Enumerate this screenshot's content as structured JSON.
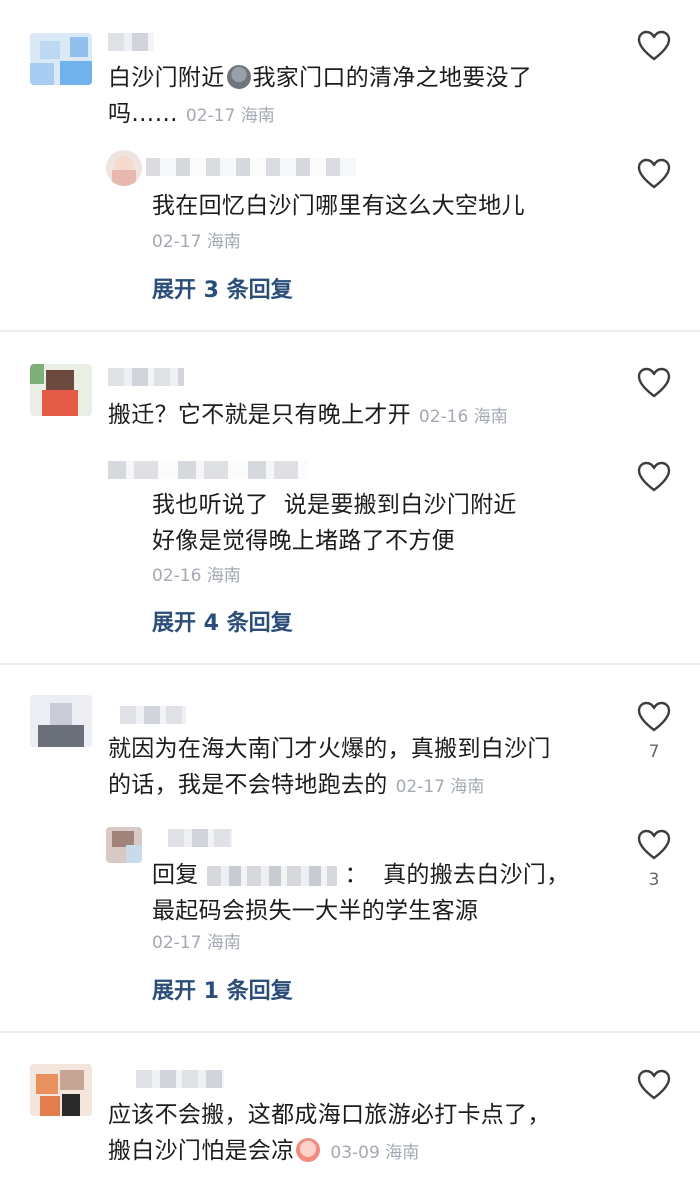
{
  "threads": [
    {
      "comment": {
        "text_lines": [
          "白沙门附近",
          "我家门口的清净之地要没了",
          "吗……"
        ],
        "emoji": "poop-emoji",
        "date": "02-17",
        "location": "海南"
      },
      "reply": {
        "text": "我在回忆白沙门哪里有这么大空地儿",
        "date": "02-17",
        "location": "海南"
      },
      "expand_label": "展开 3 条回复"
    },
    {
      "comment": {
        "text": "搬迁？它不就是只有晚上才开",
        "date": "02-16",
        "location": "海南"
      },
      "reply": {
        "text_lines": [
          "我也听说了  说是要搬到白沙门附近",
          "好像是觉得晚上堵路了不方便"
        ],
        "date": "02-16",
        "location": "海南"
      },
      "expand_label": "展开 4 条回复"
    },
    {
      "comment": {
        "text_lines": [
          "就因为在海大南门才火爆的，真搬到白沙门",
          "的话，我是不会特地跑去的"
        ],
        "date": "02-17",
        "location": "海南",
        "likes": "7"
      },
      "reply": {
        "prefix": "回复",
        "text_lines": [
          "：  真的搬去白沙门，",
          "最起码会损失一大半的学生客源"
        ],
        "date": "02-17",
        "location": "海南",
        "likes": "3"
      },
      "expand_label": "展开 1 条回复"
    },
    {
      "comment": {
        "text_lines": [
          "应该不会搬，这都成海口旅游必打卡点了，",
          "搬白沙门怕是会凉"
        ],
        "emoji": "crying-face-emoji",
        "date": "03-09",
        "location": "海南"
      }
    }
  ],
  "colors": {
    "text": "#1c1c1c",
    "meta": "#a3a8b3",
    "expand": "#2a4d7a",
    "divider": "#eeeeee"
  },
  "icons": {
    "like": "heart-outline-icon"
  }
}
